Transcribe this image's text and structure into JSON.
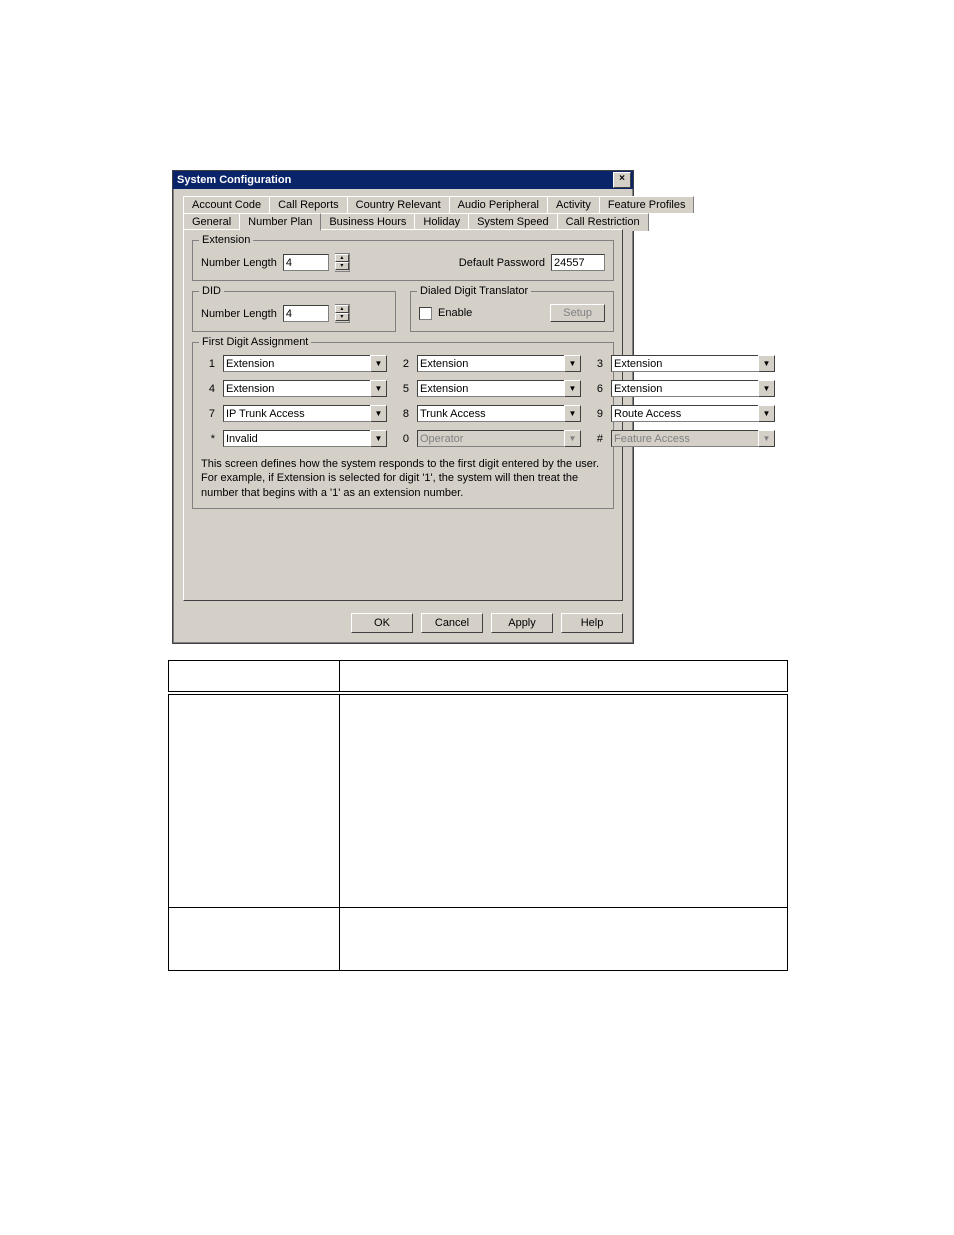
{
  "dialog": {
    "title": "System Configuration",
    "tabs_row1": [
      "Account Code",
      "Call Reports",
      "Country Relevant",
      "Audio Peripheral",
      "Activity",
      "Feature Profiles"
    ],
    "tabs_row2": [
      "General",
      "Number Plan",
      "Business Hours",
      "Holiday",
      "System Speed",
      "Call Restriction"
    ],
    "active_tab": "Number Plan",
    "extension": {
      "legend": "Extension",
      "number_length_label": "Number Length",
      "number_length_value": "4",
      "default_password_label": "Default Password",
      "default_password_value": "24557"
    },
    "did": {
      "legend": "DID",
      "number_length_label": "Number Length",
      "number_length_value": "4"
    },
    "ddt": {
      "legend": "Dialed Digit Translator",
      "enable_label": "Enable",
      "enable_checked": false,
      "setup_label": "Setup"
    },
    "fda": {
      "legend": "First Digit Assignment",
      "rows": [
        {
          "d": "1",
          "v": "Extension",
          "disabled": false
        },
        {
          "d": "2",
          "v": "Extension",
          "disabled": false
        },
        {
          "d": "3",
          "v": "Extension",
          "disabled": false
        },
        {
          "d": "4",
          "v": "Extension",
          "disabled": false
        },
        {
          "d": "5",
          "v": "Extension",
          "disabled": false
        },
        {
          "d": "6",
          "v": "Extension",
          "disabled": false
        },
        {
          "d": "7",
          "v": "IP Trunk Access",
          "disabled": false
        },
        {
          "d": "8",
          "v": "Trunk Access",
          "disabled": false
        },
        {
          "d": "9",
          "v": "Route Access",
          "disabled": false
        },
        {
          "d": "*",
          "v": "Invalid",
          "disabled": false
        },
        {
          "d": "0",
          "v": "Operator",
          "disabled": true
        },
        {
          "d": "#",
          "v": "Feature Access",
          "disabled": true
        }
      ],
      "help": "This screen defines how the system responds to the first digit entered by the user.  For example, if Extension is selected for digit '1', the system will then treat the number that begins with a '1' as an extension number."
    },
    "buttons": {
      "ok": "OK",
      "cancel": "Cancel",
      "apply": "Apply",
      "help": "Help"
    }
  },
  "doc_table": {
    "header": {
      "param": "",
      "desc": ""
    },
    "rows": [
      {
        "param": "",
        "desc": ""
      },
      {
        "param": "",
        "desc": ""
      }
    ]
  }
}
